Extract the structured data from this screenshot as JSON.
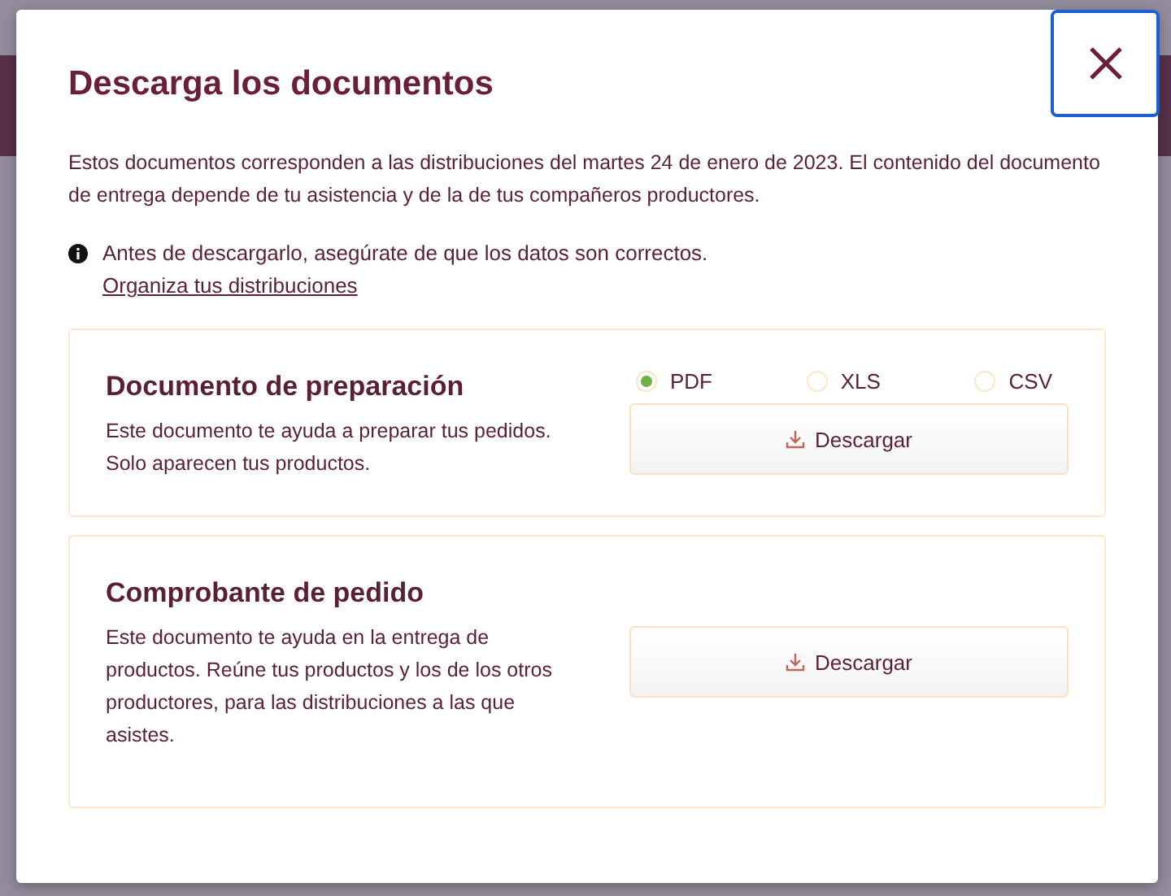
{
  "dialog": {
    "title": "Descarga los documentos",
    "intro": "Estos documentos corresponden a las distribuciones del martes 24 de enero de 2023. El contenido del documento de entrega depende de tu asistencia y de la de tus compañeros productores.",
    "notice": "Antes de descargarlo, asegúrate de que los datos son correctos.",
    "notice_link": "Organiza tus distribuciones",
    "cards": [
      {
        "title": "Documento de preparación",
        "description": "Este documento te ayuda a preparar tus pedidos. Solo aparecen tus productos.",
        "formats": [
          {
            "label": "PDF",
            "selected": true
          },
          {
            "label": "XLS",
            "selected": false
          },
          {
            "label": "CSV",
            "selected": false
          }
        ],
        "button": "Descargar"
      },
      {
        "title": "Comprobante de pedido",
        "description": "Este documento te ayuda en la entrega de productos. Reúne tus productos y los de los otros productores, para las distribuciones a las que asistes.",
        "button": "Descargar"
      }
    ]
  }
}
